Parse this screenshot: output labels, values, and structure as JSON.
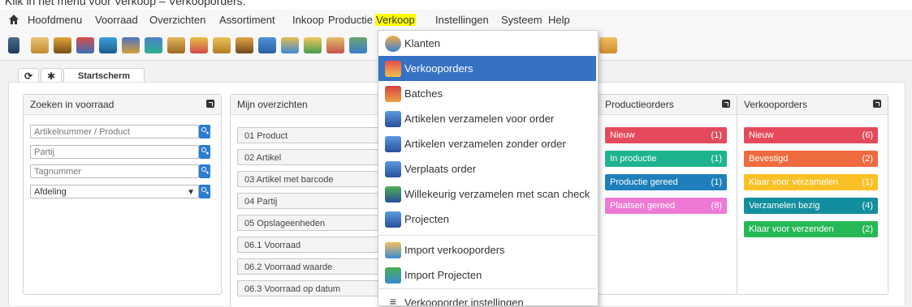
{
  "top_text": "Klik in het menu voor Verkoop – Verkooporders:",
  "menubar": {
    "items": [
      "Hoofdmenu",
      "Voorraad",
      "Overzichten",
      "Assortiment",
      "Inkoop",
      "Productie",
      "Verkoop",
      "Instellingen",
      "Systeem",
      "Help"
    ],
    "highlighted": "Verkoop"
  },
  "toolbar": {
    "icons": [
      "device-icon",
      "box-icon",
      "forklift-icon",
      "pallet-icon",
      "lift-icon",
      "rack-icon",
      "boxes-icon",
      "truck-icon",
      "box-plus-icon",
      "box-search-icon",
      "search-icon",
      "reload-icon",
      "stack-icon",
      "user-icon"
    ]
  },
  "tabs": {
    "home_label": "Startscherm"
  },
  "panels": {
    "search": {
      "title": "Zoeken in voorraad",
      "fields": [
        "Artikelnummer / Product",
        "Partij",
        "Tagnummer"
      ],
      "department": "Afdeling"
    },
    "overviews": {
      "title": "Mijn overzichten",
      "items": [
        "01 Product",
        "02 Artikel",
        "03 Artikel met barcode",
        "04 Partij",
        "05 Opslageenheden",
        "06.1 Voorraad",
        "06.2 Voorraad waarde",
        "06.3 Voorraad op datum"
      ]
    },
    "production": {
      "title": "Productieorders",
      "rows": [
        {
          "label": "Nieuw",
          "count": "(1)",
          "color": "#e44a5c"
        },
        {
          "label": "In productie",
          "count": "(1)",
          "color": "#1eb38f"
        },
        {
          "label": "Productie gereed",
          "count": "(1)",
          "color": "#1e7fbc"
        },
        {
          "label": "Plaatsen gereed",
          "count": "(8)",
          "color": "#ee79d4"
        }
      ]
    },
    "sales": {
      "title": "Verkooporders",
      "rows": [
        {
          "label": "Nieuw",
          "count": "(6)",
          "color": "#e44a5c"
        },
        {
          "label": "Bevestigd",
          "count": "(2)",
          "color": "#ee6a3f"
        },
        {
          "label": "Klaar voor verzamelen",
          "count": "(1)",
          "color": "#fac127"
        },
        {
          "label": "Verzamelen bezig",
          "count": "(4)",
          "color": "#128e9e"
        },
        {
          "label": "Klaar voor verzenden",
          "count": "(2)",
          "color": "#27b856"
        }
      ]
    }
  },
  "dropdown": {
    "items": [
      {
        "label": "Klanten",
        "icon": "customers-icon",
        "active": false
      },
      {
        "label": "Verkooporders",
        "icon": "sales-orders-icon",
        "active": true
      },
      {
        "label": "Batches",
        "icon": "batches-icon",
        "active": false
      },
      {
        "label": "Artikelen verzamelen voor order",
        "icon": "collect-for-order-icon",
        "active": false
      },
      {
        "label": "Artikelen verzamelen zonder order",
        "icon": "collect-without-order-icon",
        "active": false
      },
      {
        "label": "Verplaats order",
        "icon": "move-order-icon",
        "active": false
      },
      {
        "label": "Willekeurig verzamelen met scan check",
        "icon": "random-collect-icon",
        "active": false
      },
      {
        "label": "Projecten",
        "icon": "projects-icon",
        "active": false
      },
      {
        "label": "Import verkooporders",
        "icon": "import-sales-orders-icon",
        "active": false
      },
      {
        "label": "Import Projecten",
        "icon": "import-projects-icon",
        "active": false
      },
      {
        "label": "Verkooporder instellingen",
        "icon": "settings-sliders-icon",
        "active": false
      }
    ]
  },
  "colors": {
    "accent": "#3672c4",
    "highlight": "#ffff00",
    "search_button": "#2b7cd3"
  }
}
